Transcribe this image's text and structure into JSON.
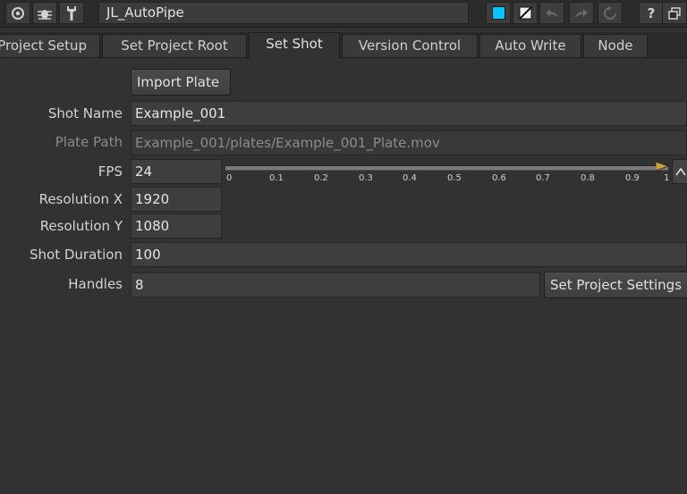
{
  "toolbar": {
    "title": "JL_AutoPipe",
    "icons_left": [
      "settings-icon",
      "bug-icon",
      "wrench-icon"
    ],
    "icons_right": [
      "cyan-swatch-icon",
      "swatch-slash-icon",
      "undo-icon",
      "redo-icon",
      "revert-icon",
      "help-icon",
      "float-window-icon"
    ],
    "help_glyph": "?",
    "accent_color": "#00c8ff"
  },
  "tabs": [
    {
      "label": "Project Setup"
    },
    {
      "label": "Set Project Root"
    },
    {
      "label": "Set Shot"
    },
    {
      "label": "Version Control"
    },
    {
      "label": "Auto Write"
    },
    {
      "label": "Node"
    }
  ],
  "active_tab": "Set Shot",
  "form": {
    "import_button": "Import Plate",
    "shot_name": {
      "label": "Shot Name",
      "value": "Example_001"
    },
    "plate_path": {
      "label": "Plate Path",
      "value": "Example_001/plates/Example_001_Plate.mov"
    },
    "fps": {
      "label": "FPS",
      "value": "24",
      "slider_ticks": [
        "0",
        "0.1",
        "0.2",
        "0.3",
        "0.4",
        "0.5",
        "0.6",
        "0.7",
        "0.8",
        "0.9",
        "1"
      ]
    },
    "resolution_x": {
      "label": "Resolution X",
      "value": "1920"
    },
    "resolution_y": {
      "label": "Resolution Y",
      "value": "1080"
    },
    "shot_duration": {
      "label": "Shot Duration",
      "value": "100"
    },
    "handles": {
      "label": "Handles",
      "value": "8"
    },
    "set_settings_button": "Set Project Settings"
  }
}
